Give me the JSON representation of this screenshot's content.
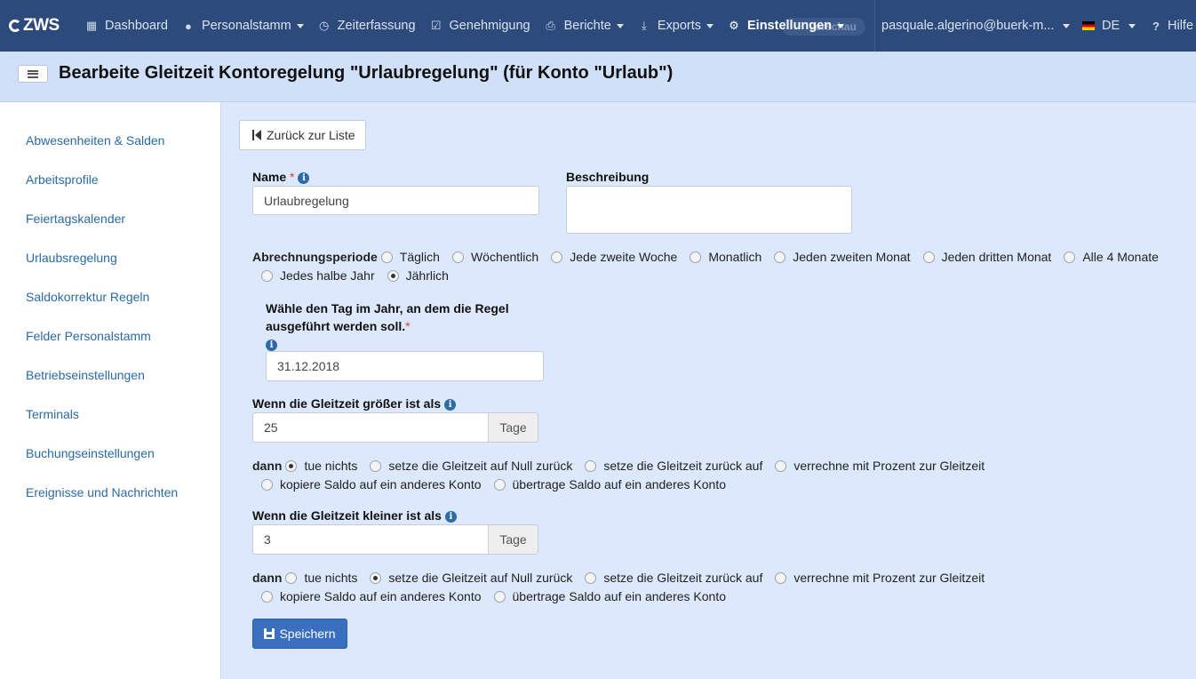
{
  "nav": {
    "logo": "ZWS",
    "items": [
      {
        "label": "Dashboard",
        "icon": "grid-icon",
        "caret": false
      },
      {
        "label": "Personalstamm",
        "icon": "user-icon",
        "caret": true
      },
      {
        "label": "Zeiterfassung",
        "icon": "clock-icon",
        "caret": false
      },
      {
        "label": "Genehmigung",
        "icon": "check-square-icon",
        "caret": false
      },
      {
        "label": "Berichte",
        "icon": "print-icon",
        "caret": true
      },
      {
        "label": "Exports",
        "icon": "download-icon",
        "caret": true
      },
      {
        "label": "Einstellungen",
        "icon": "gear-icon",
        "caret": true,
        "active": true
      }
    ],
    "preview_badge": "Vorschau",
    "user": "pasquale.algerino@buerk-m...",
    "language": "DE",
    "help": "Hilfe"
  },
  "header": {
    "title": "Bearbeite Gleitzeit Kontoregelung \"Urlaubregelung\" (für Konto \"Urlaub\")"
  },
  "sidebar": {
    "items": [
      "Abwesenheiten & Salden",
      "Arbeitsprofile",
      "Feiertagskalender",
      "Urlaubsregelung",
      "Saldokorrektur Regeln",
      "Felder Personalstamm",
      "Betriebseinstellungen",
      "Terminals",
      "Buchungseinstellungen",
      "Ereignisse und Nachrichten"
    ]
  },
  "form": {
    "back_label": "Zurück zur Liste",
    "name_label": "Name",
    "name_value": "Urlaubregelung",
    "description_label": "Beschreibung",
    "description_value": "",
    "period_label": "Abrechnungsperiode",
    "period_options": [
      "Täglich",
      "Wöchentlich",
      "Jede zweite Woche",
      "Monatlich",
      "Jeden zweiten Monat",
      "Jeden dritten Monat",
      "Alle 4 Monate",
      "Jedes halbe Jahr",
      "Jährlich"
    ],
    "period_selected": "Jährlich",
    "day_label_line1": "Wähle den Tag im Jahr, an dem die Regel",
    "day_label_line2": "ausgeführt werden soll.",
    "day_value": "31.12.2018",
    "greater_label": "Wenn die Gleitzeit größer ist als",
    "greater_value": "25",
    "unit": "Tage",
    "then_label": "dann",
    "action_options": [
      "tue nichts",
      "setze die Gleitzeit auf Null zurück",
      "setze die Gleitzeit zurück auf",
      "verrechne mit Prozent zur Gleitzeit",
      "kopiere Saldo auf ein anderes Konto",
      "übertrage Saldo auf ein anderes Konto"
    ],
    "greater_action_selected": "tue nichts",
    "less_label": "Wenn die Gleitzeit kleiner ist als",
    "less_value": "3",
    "less_action_selected": "setze die Gleitzeit auf Null zurück",
    "save_label": "Speichern"
  }
}
